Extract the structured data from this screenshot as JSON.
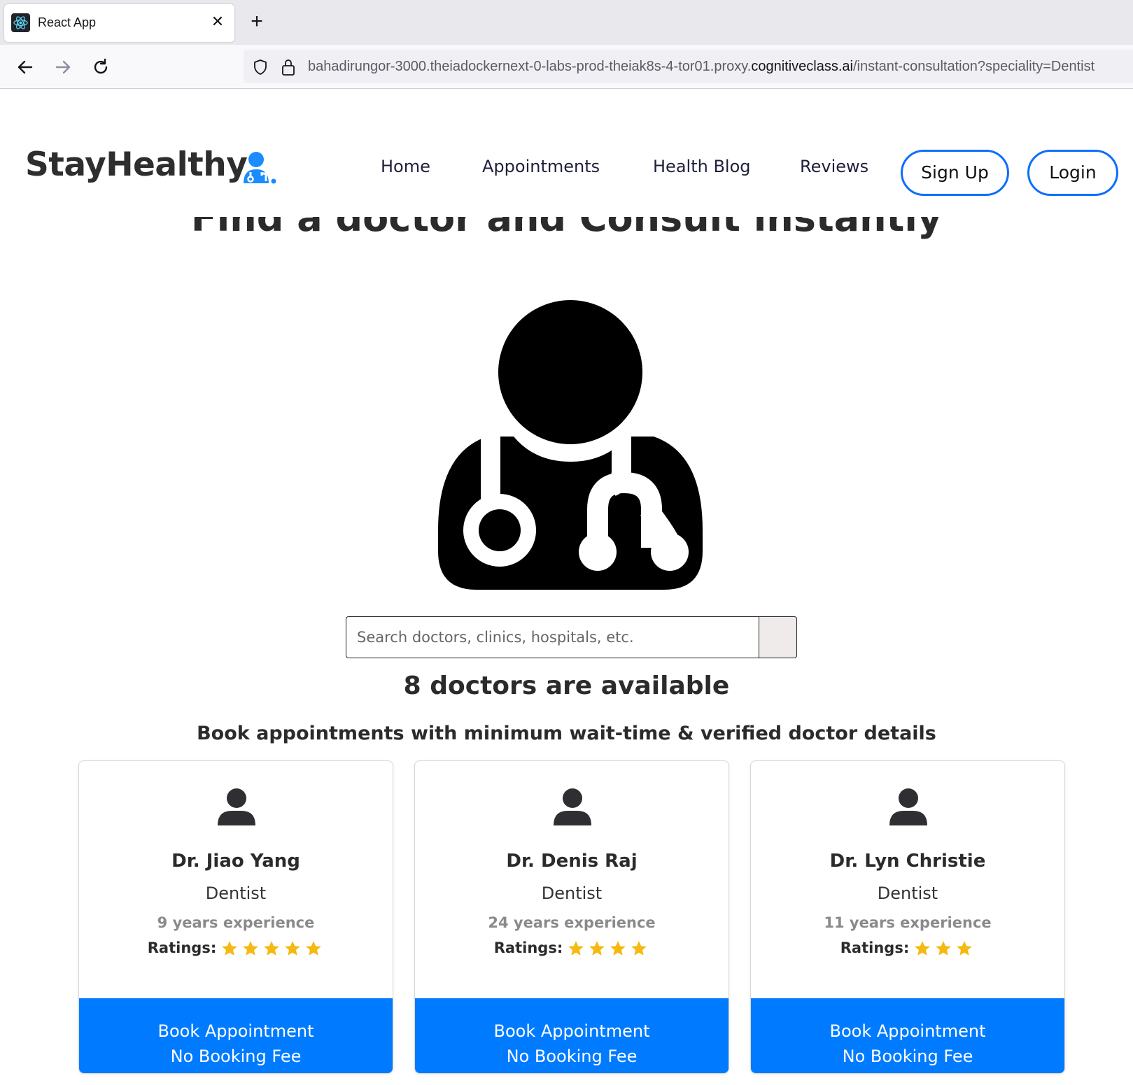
{
  "browser": {
    "tab_title": "React App",
    "url_prefix": "bahadirungor-3000.theiadockernext-0-labs-prod-theiak8s-4-tor01.proxy.",
    "url_domain": "cognitiveclass.ai",
    "url_path": "/instant-consultation?speciality=Dentist"
  },
  "header": {
    "logo_text": "StayHealthy",
    "nav": [
      "Home",
      "Appointments",
      "Health Blog",
      "Reviews"
    ],
    "signup_label": "Sign Up",
    "login_label": "Login",
    "accent_color": "#0d6efd"
  },
  "hero": {
    "title": "Find a doctor and Consult instantly",
    "search_placeholder": "Search doctors, clinics, hospitals, etc."
  },
  "results": {
    "available_text": "8 doctors are available",
    "subtitle": "Book appointments with minimum wait-time & verified doctor details",
    "ratings_label": "Ratings:",
    "doctors": [
      {
        "name": "Dr. Jiao Yang",
        "speciality": "Dentist",
        "experience": "9 years experience",
        "rating": 5
      },
      {
        "name": "Dr. Denis Raj",
        "speciality": "Dentist",
        "experience": "24 years experience",
        "rating": 4
      },
      {
        "name": "Dr. Lyn Christie",
        "speciality": "Dentist",
        "experience": "11 years experience",
        "rating": 3
      }
    ],
    "book_label": "Book Appointment",
    "fee_label": "No Booking Fee",
    "button_color": "#007bff",
    "star_color": "#f5b90f"
  }
}
